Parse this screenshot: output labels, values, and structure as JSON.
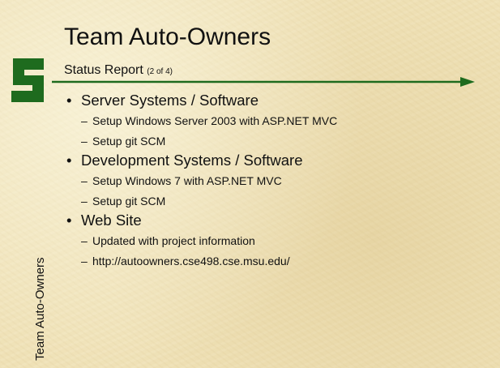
{
  "slide": {
    "title": "Team Auto-Owners",
    "subtitle": "Status Report",
    "page_count": "(2 of 4)",
    "side_label": "Team Auto-Owners",
    "logo_letter": "S",
    "bullet_glyph": "•",
    "dash_glyph": "–",
    "colors": {
      "accent_green": "#1e6b1e",
      "background": "#efe1b6"
    },
    "sections": [
      {
        "heading": "Server Systems / Software",
        "items": [
          "Setup Windows Server 2003 with ASP.NET MVC",
          "Setup git SCM"
        ]
      },
      {
        "heading": "Development Systems / Software",
        "items": [
          "Setup Windows 7 with ASP.NET MVC",
          "Setup git SCM"
        ]
      },
      {
        "heading": "Web Site",
        "items": [
          "Updated with project information",
          "http://autoowners.cse498.cse.msu.edu/"
        ]
      }
    ]
  }
}
